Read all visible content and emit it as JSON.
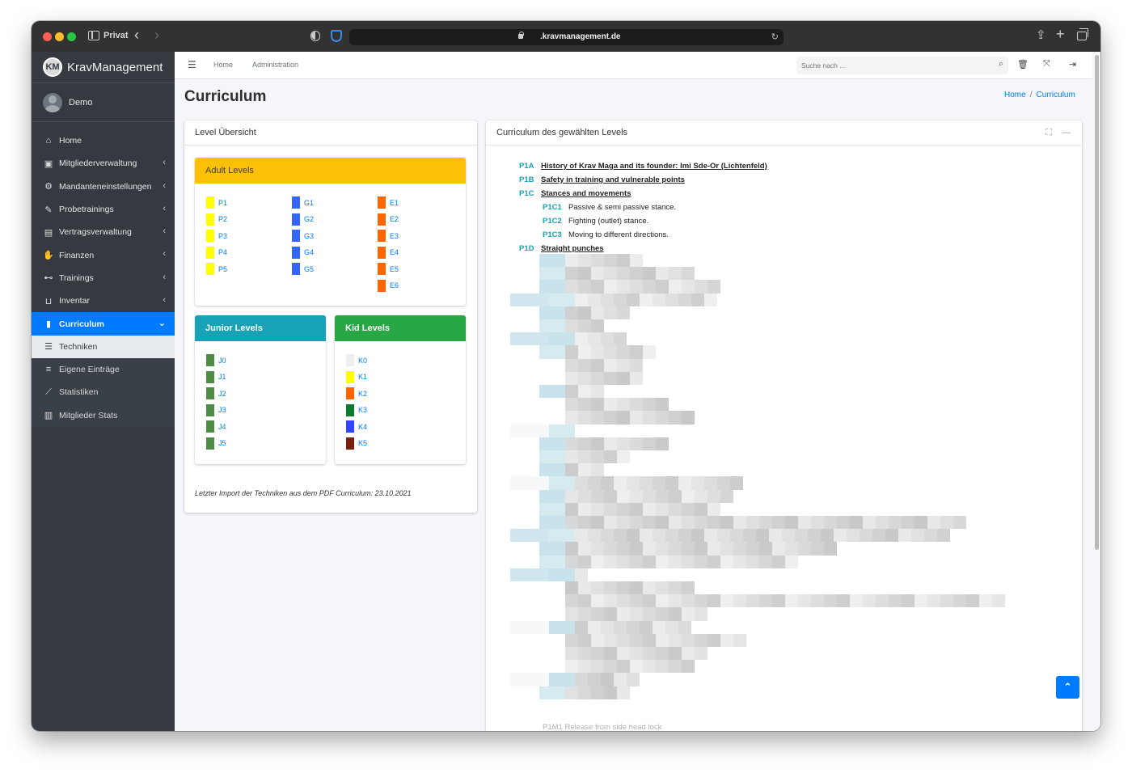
{
  "browser": {
    "profile": "Privat",
    "url": ".kravmanagement.de"
  },
  "sidebar": {
    "brand": "KravManagement",
    "brand_logo": "KM",
    "user": "Demo",
    "items": [
      {
        "label": "Home",
        "icon": "home-icon"
      },
      {
        "label": "Mitgliederverwaltung",
        "icon": "id-card-icon"
      },
      {
        "label": "Mandanteneinstellungen",
        "icon": "cogs-icon"
      },
      {
        "label": "Probetrainings",
        "icon": "pen-icon"
      },
      {
        "label": "Vertragsverwaltung",
        "icon": "file-contract-icon"
      },
      {
        "label": "Finanzen",
        "icon": "hand-coin-icon"
      },
      {
        "label": "Trainings",
        "icon": "dumbbell-icon"
      },
      {
        "label": "Inventar",
        "icon": "dolly-icon"
      },
      {
        "label": "Curriculum",
        "icon": "book-icon"
      }
    ],
    "submenu": [
      {
        "label": "Techniken",
        "icon": "list-ol-icon"
      },
      {
        "label": "Eigene Einträge",
        "icon": "bars-icon"
      },
      {
        "label": "Statistiken",
        "icon": "chart-line-icon"
      },
      {
        "label": "Mitglieder Stats",
        "icon": "chart-bar-icon"
      }
    ]
  },
  "navbar": {
    "links": [
      "Home",
      "Administration"
    ],
    "search_placeholder": "Suche nach ..."
  },
  "page": {
    "title": "Curriculum",
    "breadcrumb": [
      "Home",
      "Curriculum"
    ]
  },
  "left_card": {
    "title": "Level Übersicht",
    "adult": {
      "title": "Adult Levels",
      "columns": [
        [
          {
            "label": "P1",
            "color": "#ffff00"
          },
          {
            "label": "P2",
            "color": "#ffff00"
          },
          {
            "label": "P3",
            "color": "#ffff00"
          },
          {
            "label": "P4",
            "color": "#ffff00"
          },
          {
            "label": "P5",
            "color": "#ffff00"
          }
        ],
        [
          {
            "label": "G1",
            "color": "#3366ff"
          },
          {
            "label": "G2",
            "color": "#3366ff"
          },
          {
            "label": "G3",
            "color": "#3366ff"
          },
          {
            "label": "G4",
            "color": "#3366ff"
          },
          {
            "label": "G5",
            "color": "#3366ff"
          }
        ],
        [
          {
            "label": "E1",
            "color": "#ff6600"
          },
          {
            "label": "E2",
            "color": "#ff6600"
          },
          {
            "label": "E3",
            "color": "#ff6600"
          },
          {
            "label": "E4",
            "color": "#ff6600"
          },
          {
            "label": "E5",
            "color": "#ff6600"
          },
          {
            "label": "E6",
            "color": "#ff6600"
          }
        ]
      ]
    },
    "junior": {
      "title": "Junior Levels",
      "items": [
        {
          "label": "J0",
          "color": "#4e8b45"
        },
        {
          "label": "J1",
          "color": "#4e8b45"
        },
        {
          "label": "J2",
          "color": "#4e8b45"
        },
        {
          "label": "J3",
          "color": "#4e8b45"
        },
        {
          "label": "J4",
          "color": "#4e8b45"
        },
        {
          "label": "J5",
          "color": "#4e8b45"
        }
      ]
    },
    "kid": {
      "title": "Kid Levels",
      "items": [
        {
          "label": "K0",
          "color": "#eeeeee"
        },
        {
          "label": "K1",
          "color": "#ffff00"
        },
        {
          "label": "K2",
          "color": "#ff6600"
        },
        {
          "label": "K3",
          "color": "#0d7a2e"
        },
        {
          "label": "K4",
          "color": "#3344ff"
        },
        {
          "label": "K5",
          "color": "#7a1e0e"
        }
      ]
    },
    "import_note": "Letzter Import der Techniken aus dem PDF Curriculum: 23.10.2021"
  },
  "right_card": {
    "title": "Curriculum des gewählten Levels",
    "entries": [
      {
        "code": "P1A",
        "text": "History of Krav Maga and its founder: Imi Sde-Or (Lichtenfeld)",
        "level": 0
      },
      {
        "code": "P1B",
        "text": "Safety in training and vulnerable points",
        "level": 0
      },
      {
        "code": "P1C",
        "text": "Stances and movements",
        "level": 0
      },
      {
        "code": "P1C1",
        "text": "Passive & semi passive stance.",
        "level": 1
      },
      {
        "code": "P1C2",
        "text": "Fighting (outlet) stance.",
        "level": 1
      },
      {
        "code": "P1C3",
        "text": "Moving to different directions.",
        "level": 1
      },
      {
        "code": "P1D",
        "text": "Straight punches",
        "level": 0
      }
    ],
    "cut_off_line": "P1M1  Release from side head lock"
  }
}
